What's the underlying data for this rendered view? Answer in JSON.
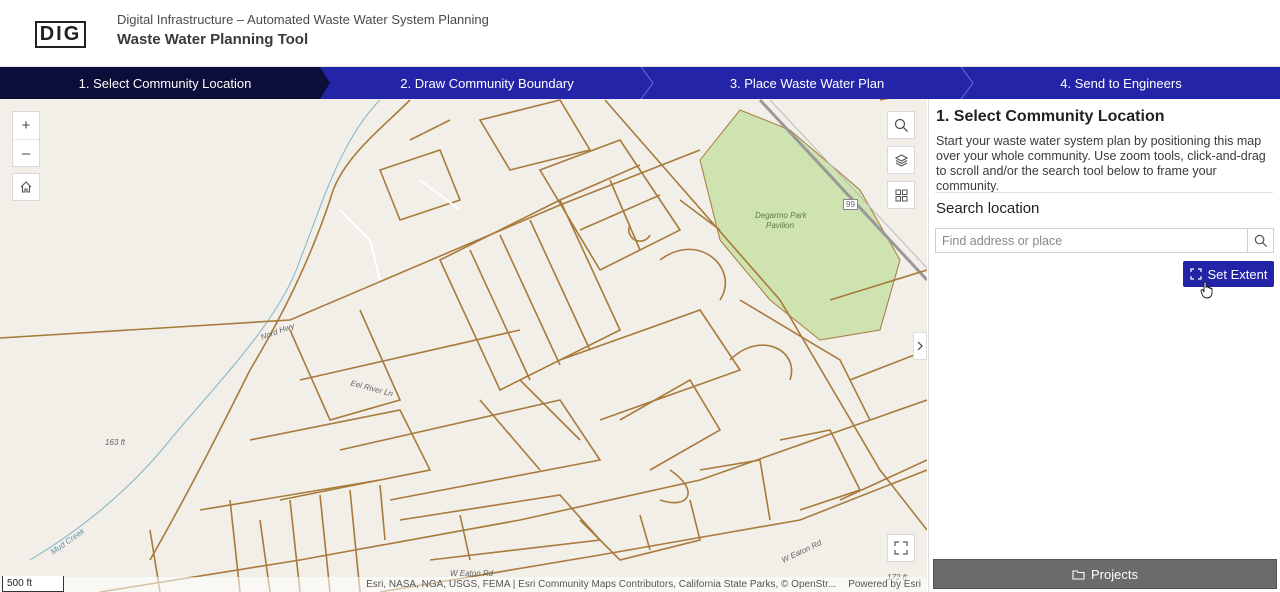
{
  "header": {
    "logo_text": "DIG",
    "subtitle": "Digital Infrastructure – Automated Waste Water System Planning",
    "title": "Waste Water Planning Tool"
  },
  "steps": [
    {
      "label": "1. Select Community Location",
      "active": true
    },
    {
      "label": "2. Draw Community Boundary",
      "active": false
    },
    {
      "label": "3. Place Waste Water Plan",
      "active": false
    },
    {
      "label": "4. Send to Engineers",
      "active": false
    }
  ],
  "map": {
    "zoom_in": "+",
    "zoom_out": "–",
    "labels": {
      "park": "Degarmo Park",
      "pavilion": "Pavilion",
      "elevation_1": "163 ft",
      "elevation_2": "172 ft",
      "creek": "Mud Creek",
      "road_marker": "99",
      "street_1": "W Eaton Rd",
      "street_2": "W Eaton Rd",
      "street_3": "Eel River Ln",
      "street_4": "Nord Hwy"
    },
    "scale": "500 ft",
    "attribution": "Esri, NASA, NGA, USGS, FEMA | Esri Community Maps Contributors, California State Parks, © OpenStr...",
    "powered_by": "Powered by Esri"
  },
  "panel": {
    "title": "1. Select Community Location",
    "description": "Start your waste water system plan by positioning this map over your whole community. Use zoom tools, click-and-drag to scroll and/or the search tool below to frame your community.",
    "search_label": "Search location",
    "search_placeholder": "Find address or place",
    "set_extent_label": "Set Extent",
    "projects_label": "Projects"
  },
  "colors": {
    "primary": "#2424a8",
    "active_step": "#0d0d3a",
    "street": "#a87a3c",
    "park": "#cfe3b0",
    "map_bg": "#f1efe7"
  }
}
